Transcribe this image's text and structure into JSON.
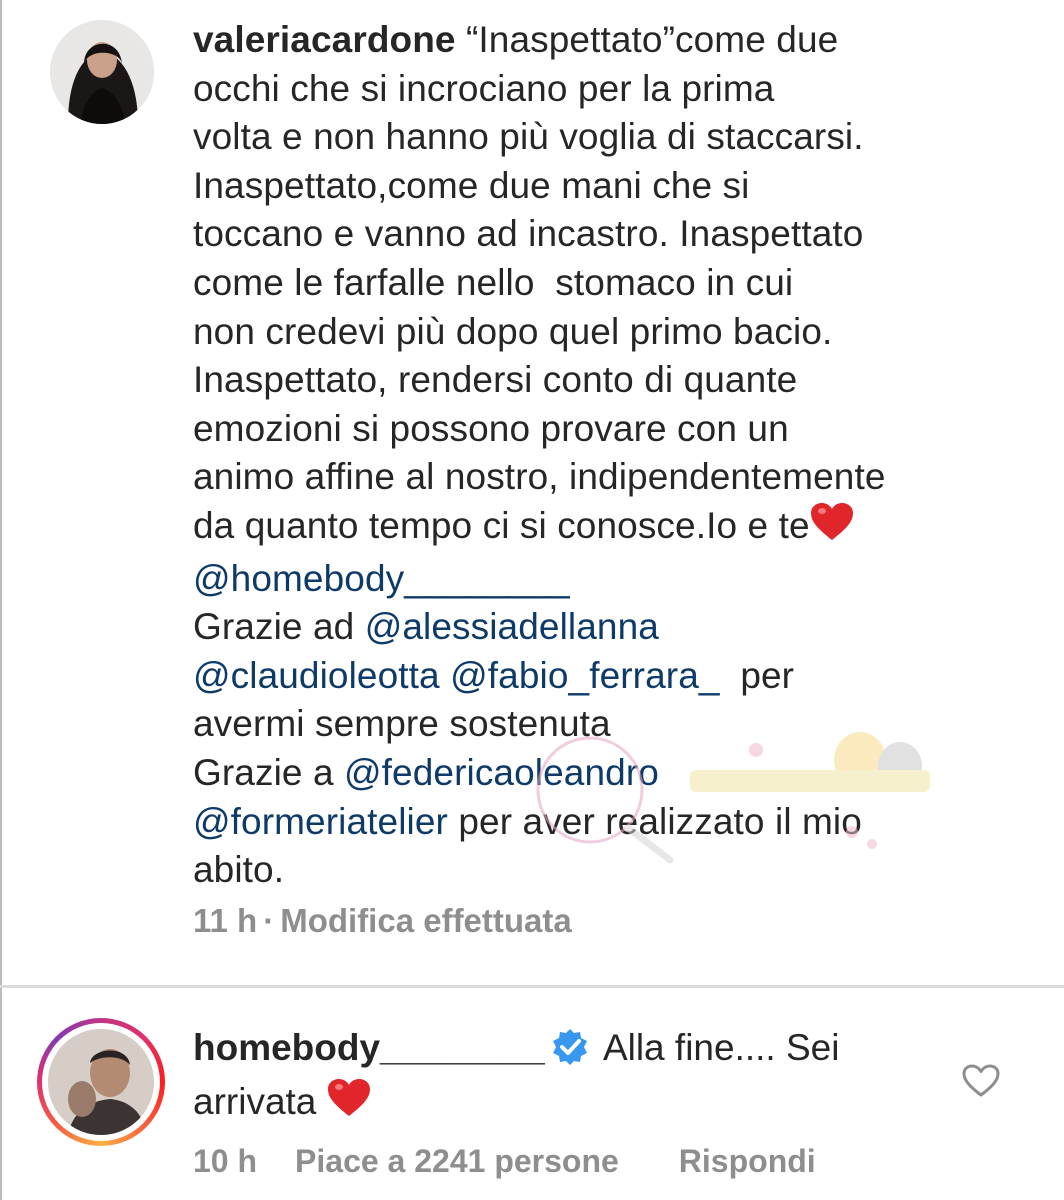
{
  "caption": {
    "username": "valeriacardone",
    "lines": [
      "“Inaspettato”come due",
      "occhi che si incrociano per la prima",
      "volta e non hanno più voglia di staccarsi.",
      "Inaspettato,come due mani che si",
      "toccano e vanno ad incastro. Inaspettato",
      "come le farfalle nello  stomaco in cui",
      "non credevi più dopo quel primo bacio.",
      "Inaspettato, rendersi conto di quante",
      "emozioni si possono provare con un",
      "animo affine al nostro, indipendentemente",
      "da quanto tempo ci si conosce.Io e te"
    ],
    "mention_homebody": "@homebody________",
    "thanks_1_prefix": "Grazie ad ",
    "mention_alessia": "@alessiadellanna",
    "mention_claudio": "@claudioleotta",
    "mention_fabio": "@fabio_ferrara_",
    "thanks_1_suffix": "  per",
    "thanks_1_line2": "avermi sempre sostenuta",
    "thanks_2_prefix": "Grazie a ",
    "mention_federica": "@federicaoleandro",
    "mention_formeria": "@formeriatelier",
    "thanks_2_suffix": " per aver realizzato il mio",
    "thanks_2_line2": "abito.",
    "time": "11 h",
    "separator": "·",
    "edited": "Modifica effettuata"
  },
  "reply": {
    "username": "homebody________",
    "text_part1": "Alla fine.... Sei",
    "text_part2": "arrivata",
    "time": "10 h",
    "likes": "Piace a 2241 persone",
    "reply_label": "Rispondi"
  },
  "icons": {
    "heart_emoji": "red-heart-emoji",
    "verified": "verified-badge-icon",
    "like": "heart-outline-icon"
  },
  "colors": {
    "text": "#262626",
    "mention": "#0d3a69",
    "meta": "#8e8e8e",
    "verified": "#3897f0",
    "heart": "#e0252b"
  }
}
